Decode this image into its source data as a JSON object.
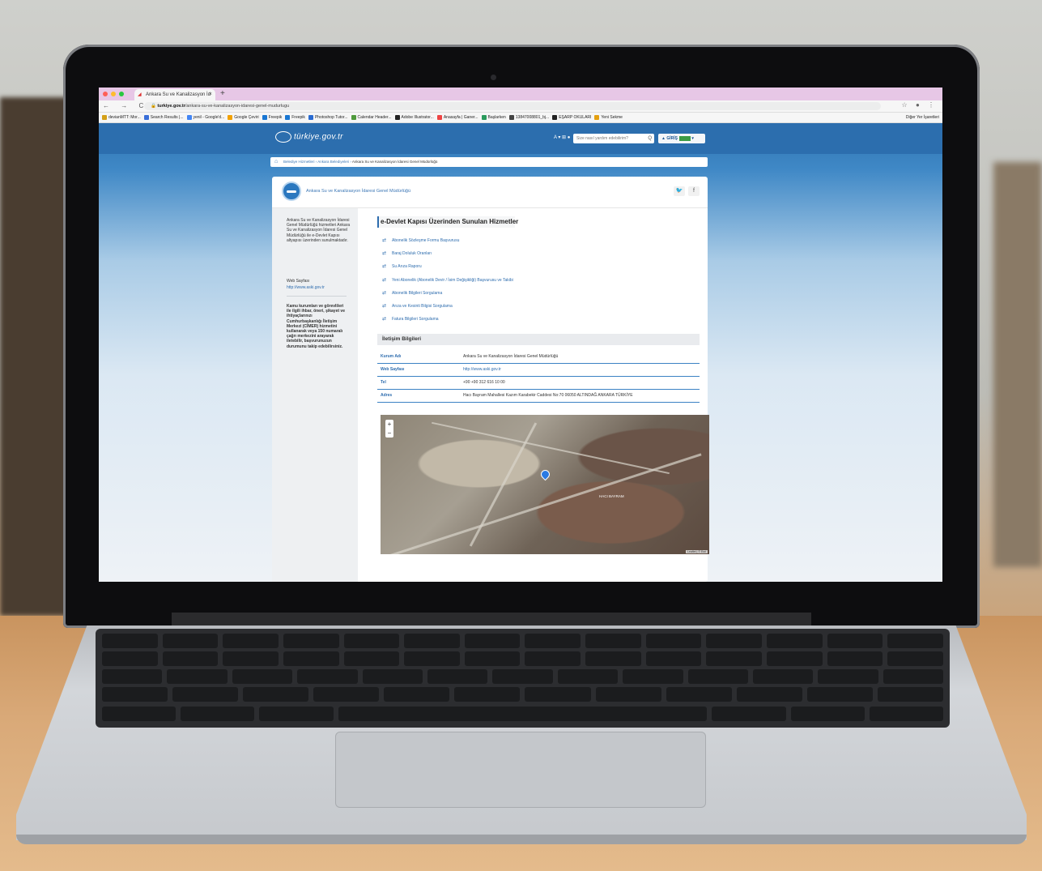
{
  "browser": {
    "tab_title": "Ankara Su ve Kanalizasyon İd",
    "tab_close": "×",
    "new_tab": "+",
    "nav_buttons": "← → C ⌂",
    "url_host": "turkiye.gov.tr",
    "url_path": "/ankara-su-ve-kanalizasyon-idaresi-genel-mudurlugu",
    "addr_right": "☆ ● ⋮",
    "bookmarks": [
      "devianMTT: Mor...",
      "Search Results |...",
      "yenil - Google'd...",
      "Google Çeviri",
      "Freepik",
      "Freepik",
      "Photoshop Tutor...",
      "Calendar Header...",
      "Adobe Illustrator...",
      "Anasayfa | Ganer...",
      "Başlarken",
      "13847008801_bj...",
      "EŞARP OKULARI",
      "Yeni Sekme"
    ],
    "bookmarks_other": "Diğer Yer İşaretleri"
  },
  "header": {
    "logo_text": "türkiye.gov.tr",
    "a11y": "A ▾  ⊞ ●",
    "search_placeholder": "Size nasıl yardım edebilirim?",
    "search_icon": "Q",
    "login_label": "▲ GİRİŞ"
  },
  "breadcrumb": {
    "home_icon": "⌂",
    "items": [
      "Belediye Hizmetleri",
      "Ankara Belediyeleri"
    ],
    "separator": "›",
    "current": "Ankara Su ve Kanalizasyon İdaresi Genel Müdürlüğü"
  },
  "institution": {
    "name": "Ankara Su ve Kanalizasyon İdaresi Genel Müdürlüğü",
    "social": [
      "🐦",
      "f"
    ]
  },
  "sidebar": {
    "description": "Ankara Su ve Kanalizasyon İdaresi Genel Müdürlüğü hizmetleri Ankara Su ve Kanalizasyon İdaresi Genel Müdürlüğü ile e-Devlet Kapısı altyapısı üzerinden sunulmaktadır.",
    "web_label": "Web Sayfası",
    "web_url": "http://www.aski.gov.tr",
    "note": "Kamu kurumları ve görevlileri ile ilgili ihbar, öneri, şikayet ve ihtiyaçlarınızı Cumhurbaşkanlığı İletişim Merkezi (CİMER) hizmetini kullanarak veya 150 numaralı çağrı merkezini arayarak iletebilir, başvurunuzun durumunu takip edebilirsiniz."
  },
  "services": {
    "title": "e-Devlet Kapısı Üzerinden Sunulan Hizmetler",
    "items": [
      "Abonelik Sözleşme Formu Başvurusu",
      "Baraj Doluluk Oranları",
      "Su Arıza Raporu",
      "Yeni Abonelik (Abonelik Devir / İsim Değişikliği) Başvurusu ve Takibi",
      "Abonelik Bilgileri Sorgulama",
      "Arıza ve Kesinti Bilgisi Sorgulama",
      "Fatura Bilgileri Sorgulama"
    ]
  },
  "contact": {
    "title": "İletişim Bilgileri",
    "rows": [
      {
        "k": "Kurum Adı",
        "v": "Ankara Su ve Kanalizasyon İdaresi Genel Müdürlüğü"
      },
      {
        "k": "Web Sayfası",
        "v": "http://www.aski.gov.tr"
      },
      {
        "k": "Tel",
        "v": "+90 +90 312 616 10 00"
      },
      {
        "k": "Adres",
        "v": "Hacı Bayram Mahallesi Kazım Karabekir Caddesi No:70 06050 ALTINDAĞ ANKARA TÜRKİYE"
      }
    ]
  },
  "map": {
    "zoom_in": "+",
    "zoom_out": "−",
    "label": "HACI BAYRAM",
    "attribution": "Leaflet | © Esri"
  }
}
